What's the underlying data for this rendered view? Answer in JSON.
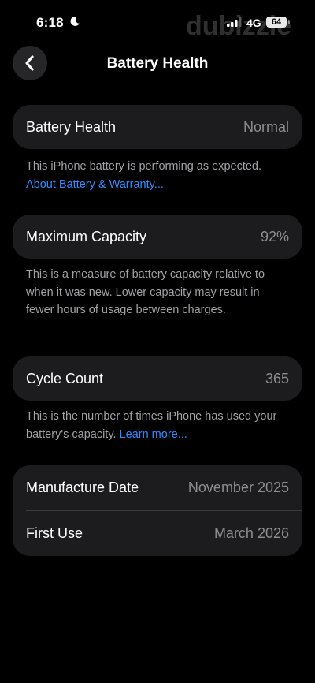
{
  "status_bar": {
    "time": "6:18",
    "network": "4G",
    "battery_level": "64",
    "watermark": "dubizzle"
  },
  "header": {
    "title": "Battery Health"
  },
  "battery_health": {
    "label": "Battery Health",
    "value": "Normal",
    "note": "This iPhone battery is performing as expected.",
    "link": "About Battery & Warranty..."
  },
  "maximum_capacity": {
    "label": "Maximum Capacity",
    "value": "92%",
    "note": "This is a measure of battery capacity relative to when it was new. Lower capacity may result in fewer hours of usage between charges."
  },
  "cycle_count": {
    "label": "Cycle Count",
    "value": "365",
    "note": "This is the number of times iPhone has used your battery's capacity.",
    "link": "Learn more..."
  },
  "dates": {
    "manufacture_label": "Manufacture Date",
    "manufacture_value": "November 2025",
    "first_use_label": "First Use",
    "first_use_value": "March 2026"
  },
  "icons": {
    "back": "chevron-left-icon",
    "moon": "moon-icon",
    "signal": "cellular-signal-icon",
    "battery": "battery-icon"
  },
  "colors": {
    "background": "#000000",
    "card": "#1c1c1e",
    "link": "#2f8cff",
    "secondary_text": "#8d8d92"
  }
}
